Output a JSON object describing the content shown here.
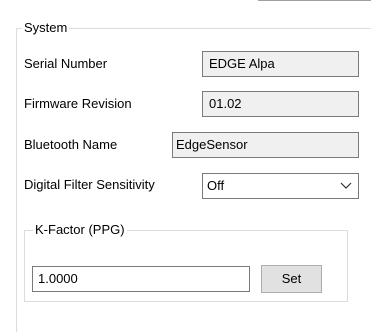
{
  "system": {
    "title": "System",
    "serial_number": {
      "label": "Serial Number",
      "value": "EDGE Alpa"
    },
    "firmware_revision": {
      "label": "Firmware Revision",
      "value": "01.02"
    },
    "bluetooth_name": {
      "label": "Bluetooth Name",
      "value": "EdgeSensor"
    },
    "digital_filter": {
      "label": "Digital Filter Sensitivity",
      "selected": "Off"
    },
    "kfactor": {
      "title": "K-Factor (PPG)",
      "value": "1.0000",
      "set_label": "Set"
    }
  }
}
